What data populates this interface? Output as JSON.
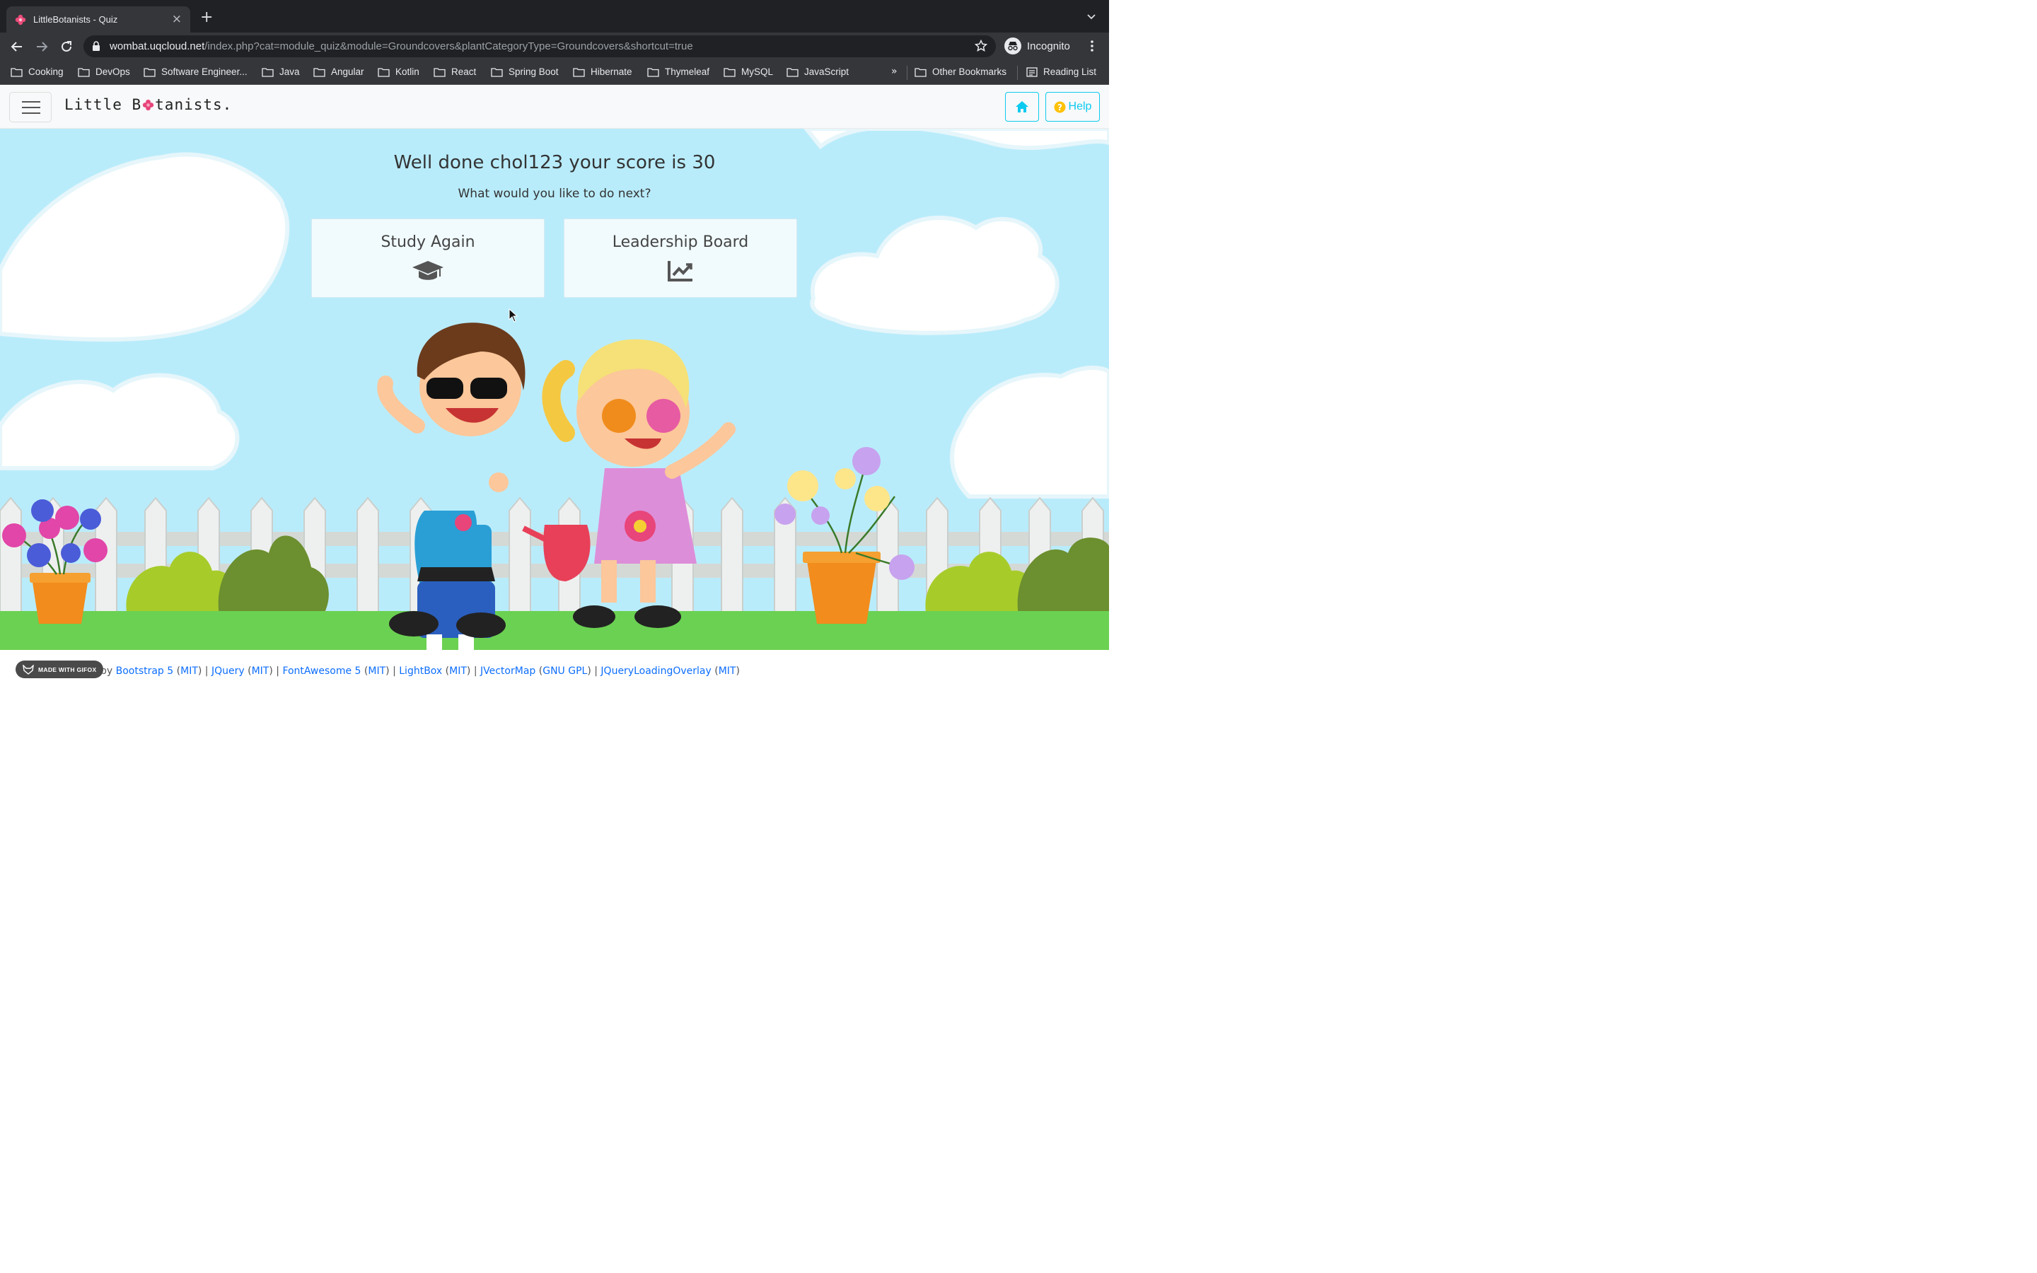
{
  "browser": {
    "tab_title": "LittleBotanists - Quiz",
    "url_host": "wombat.uqcloud.net",
    "url_path": "/index.php?cat=module_quiz&module=Groundcovers&plantCategoryType=Groundcovers&shortcut=true",
    "profile_label": "Incognito",
    "bookmarks": [
      "Cooking",
      "DevOps",
      "Software Engineer...",
      "Java",
      "Angular",
      "Kotlin",
      "React",
      "Spring Boot",
      "Hibernate",
      "Thymeleaf",
      "MySQL",
      "JavaScript"
    ],
    "more_label": "»",
    "other_bookmarks": "Other Bookmarks",
    "reading_list": "Reading List"
  },
  "site": {
    "brand_before": "Little B",
    "brand_after": "tanists.",
    "help_label": "Help",
    "home_icon": "home-icon",
    "menu_icon": "hamburger-icon"
  },
  "result": {
    "title": "Well done chol123 your score is 30",
    "subtitle": "What would you like to do next?",
    "actions": [
      {
        "label": "Study Again",
        "icon": "graduation-cap-icon"
      },
      {
        "label": "Leadership Board",
        "icon": "chart-line-icon"
      }
    ]
  },
  "footer": {
    "prefix": "Powered by ",
    "links": [
      {
        "name": "Bootstrap 5",
        "license": "MIT"
      },
      {
        "name": "JQuery",
        "license": "MIT"
      },
      {
        "name": "FontAwesome 5",
        "license": "MIT"
      },
      {
        "name": "LightBox",
        "license": "MIT"
      },
      {
        "name": "JVectorMap",
        "license": "GNU GPL"
      },
      {
        "name": "JQueryLoadingOverlay",
        "license": "MIT"
      }
    ],
    "watermark": "MADE WITH GIFOX"
  },
  "colors": {
    "sky": "#b9ecfb",
    "grass": "#6bd152",
    "accent_info": "#0dcaf0",
    "link": "#0d6efd"
  }
}
